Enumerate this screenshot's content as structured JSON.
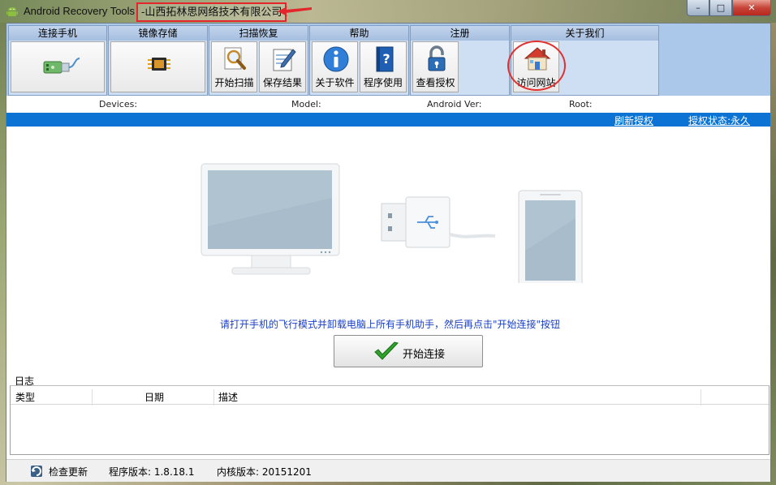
{
  "window": {
    "title": "Android Recovery Tools",
    "company": "-山西拓林思网络技术有限公司",
    "controls": {
      "minimize": "–",
      "maximize": "□",
      "close": "✕"
    }
  },
  "ribbon": {
    "groups": [
      {
        "title": "连接手机",
        "buttons": [
          {
            "label": "",
            "icon": "usb-connect-icon"
          }
        ]
      },
      {
        "title": "镜像存储",
        "buttons": [
          {
            "label": "",
            "icon": "chip-icon"
          }
        ]
      },
      {
        "title": "扫描恢复",
        "buttons": [
          {
            "label": "开始扫描",
            "icon": "magnifier-icon"
          },
          {
            "label": "保存结果",
            "icon": "save-document-icon"
          }
        ]
      },
      {
        "title": "帮助",
        "buttons": [
          {
            "label": "关于软件",
            "icon": "info-icon"
          },
          {
            "label": "程序使用",
            "icon": "help-book-icon"
          }
        ]
      },
      {
        "title": "注册",
        "buttons": [
          {
            "label": "查看授权",
            "icon": "padlock-icon"
          }
        ]
      },
      {
        "title": "关于我们",
        "buttons": [
          {
            "label": "访问网站",
            "icon": "house-icon"
          }
        ]
      }
    ]
  },
  "device_info": {
    "devices": "Devices:",
    "model": "Model:",
    "android_ver": "Android Ver:",
    "root": "Root:"
  },
  "status_links": {
    "refresh": "刷新授权",
    "auth_status": "授权状态:永久"
  },
  "main": {
    "hint": "请打开手机的飞行模式并卸载电脑上所有手机助手，然后再点击\"开始连接\"按钮",
    "connect_label": "开始连接"
  },
  "log": {
    "title": "日志",
    "columns": [
      "类型",
      "日期",
      "描述"
    ]
  },
  "status_bar": {
    "check_update": "检查更新",
    "program_version": "程序版本: 1.8.18.1",
    "core_version": "内核版本: 20151201"
  },
  "colors": {
    "accent_blue": "#0b73d4",
    "ribbon_bg": "#abc8ea",
    "annotation_red": "#e3262b",
    "hint_text": "#1a3fc2"
  }
}
